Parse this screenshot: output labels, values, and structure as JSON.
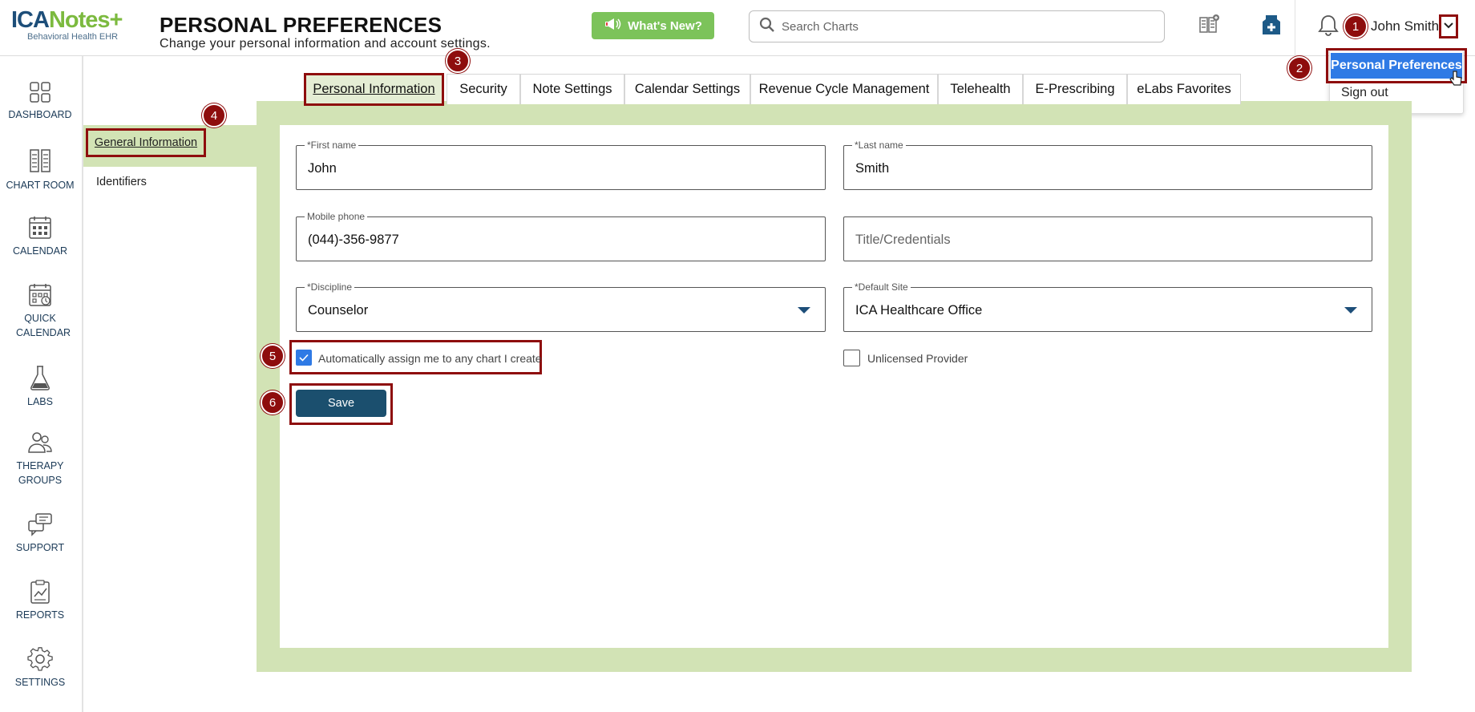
{
  "header": {
    "logo_text_1": "ICA",
    "logo_text_2": "Notes",
    "logo_tagline": "Behavioral Health EHR",
    "title": "PERSONAL PREFERENCES",
    "subtitle": "Change your personal information and account settings.",
    "whats_new": "What's New?",
    "search_placeholder": "Search Charts",
    "user_name": "John Smith"
  },
  "user_menu": {
    "items": [
      "Personal Preferences",
      "Sign out"
    ]
  },
  "sidebar": {
    "items": [
      {
        "label": "DASHBOARD",
        "icon": "dashboard-icon"
      },
      {
        "label": "CHART ROOM",
        "icon": "chart-room-icon"
      },
      {
        "label": "CALENDAR",
        "icon": "calendar-icon"
      },
      {
        "label": "QUICK CALENDAR",
        "icon": "quick-calendar-icon"
      },
      {
        "label": "LABS",
        "icon": "flask-icon"
      },
      {
        "label": "THERAPY GROUPS",
        "icon": "groups-icon"
      },
      {
        "label": "SUPPORT",
        "icon": "support-chat-icon"
      },
      {
        "label": "REPORTS",
        "icon": "reports-icon"
      },
      {
        "label": "SETTINGS",
        "icon": "gear-icon"
      }
    ]
  },
  "tabs": [
    "Personal Information",
    "Security",
    "Note Settings",
    "Calendar Settings",
    "Revenue Cycle Management",
    "Telehealth",
    "E-Prescribing",
    "eLabs Favorites"
  ],
  "subnav": [
    "General Information",
    "Identifiers"
  ],
  "form": {
    "first_name": {
      "label": "*First name",
      "value": "John"
    },
    "last_name": {
      "label": "*Last name",
      "value": "Smith"
    },
    "mobile": {
      "label": "Mobile phone",
      "value": "(044)-356-9877"
    },
    "title_credentials": {
      "placeholder": "Title/Credentials"
    },
    "discipline": {
      "label": "*Discipline",
      "value": "Counselor"
    },
    "default_site": {
      "label": "*Default Site",
      "value": "ICA Healthcare Office"
    },
    "auto_assign": {
      "label": "Automatically assign me to any chart I create",
      "checked": true
    },
    "unlicensed": {
      "label": "Unlicensed Provider",
      "checked": false
    },
    "save": "Save"
  },
  "steps": [
    "1",
    "2",
    "3",
    "4",
    "5",
    "6"
  ],
  "colors": {
    "accent_green": "#7cc35a",
    "panel_green": "#d2e3b5",
    "highlight_red": "#8e0d0d",
    "primary_blue": "#2f7ae5",
    "save_navy": "#1b4f6e"
  }
}
